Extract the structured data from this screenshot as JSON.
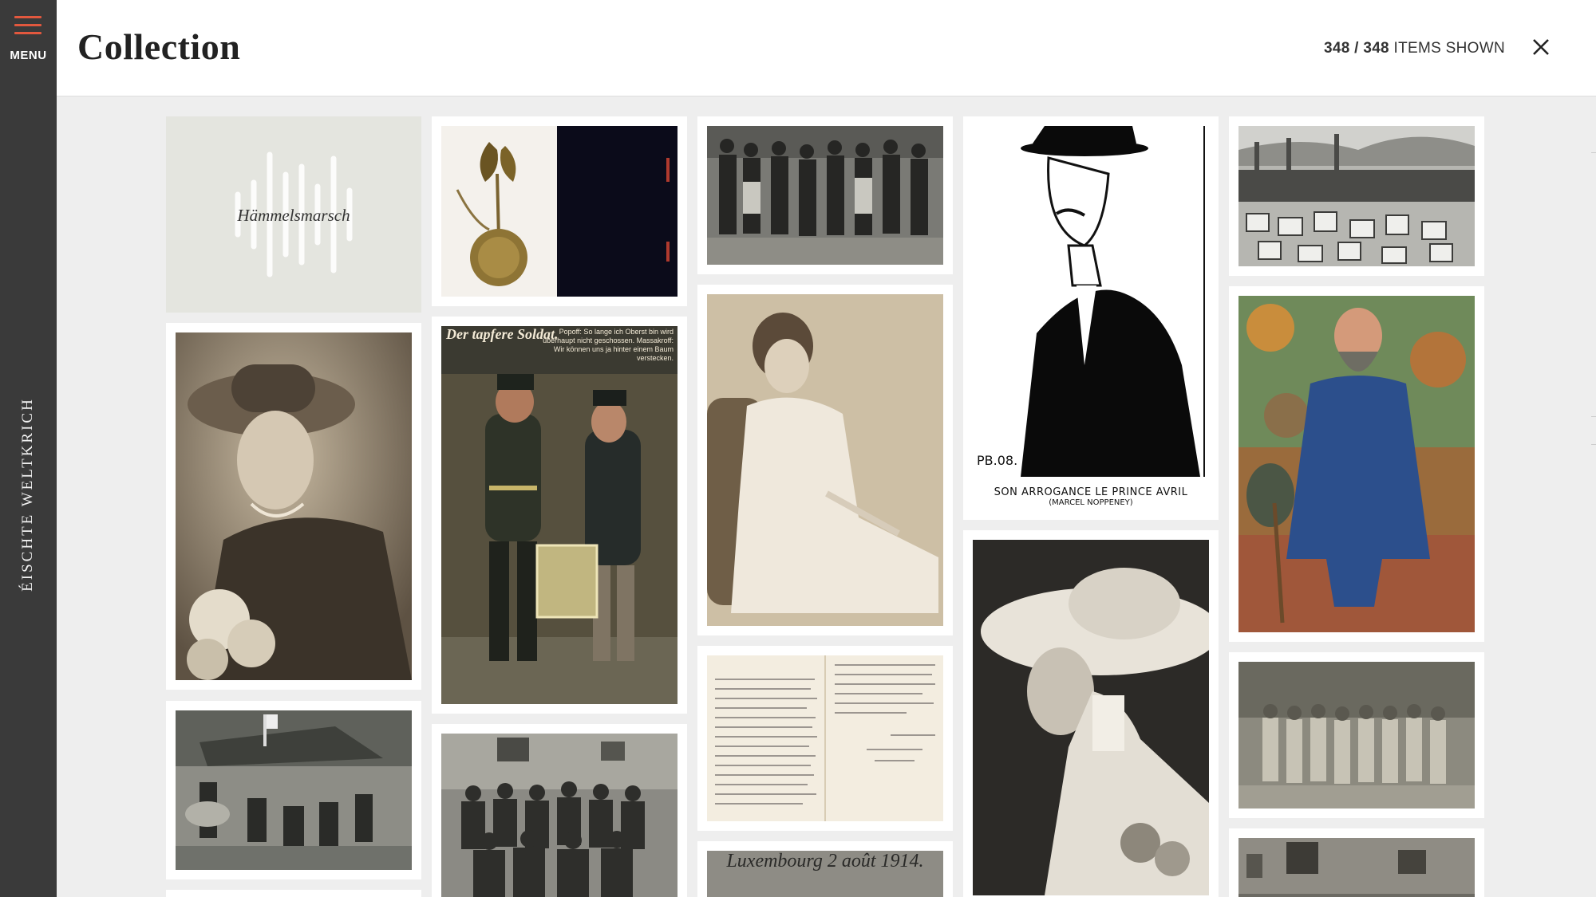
{
  "sidebar": {
    "menu_label": "MENU",
    "site_title": "ÉISCHTE WELTKRICH"
  },
  "header": {
    "title": "Collection",
    "count_shown": "348",
    "count_total": "348",
    "count_suffix": "ITEMS SHOWN"
  },
  "items": {
    "audio_title": "Hämmelsmarsch",
    "caricature_caption_line1": "SON ARROGANCE LE PRINCE AVRIL",
    "caricature_caption_line2": "(MARCEL NOPPENEY)",
    "postcard_title": "Der tapfere Soldat.",
    "postcard_text": "Popoff: So lange ich Oberst bin wird überhaupt nicht geschossen. Massakroff: Wir können uns ja hinter einem Baum verstecken.",
    "stamp_text": "Luxembourg 2 août 1914."
  },
  "colors": {
    "sidebar_bg": "#3a3a3a",
    "accent": "#e2583e",
    "page_bg": "#eeeeee",
    "audio_card_bg": "#e4e5df"
  }
}
